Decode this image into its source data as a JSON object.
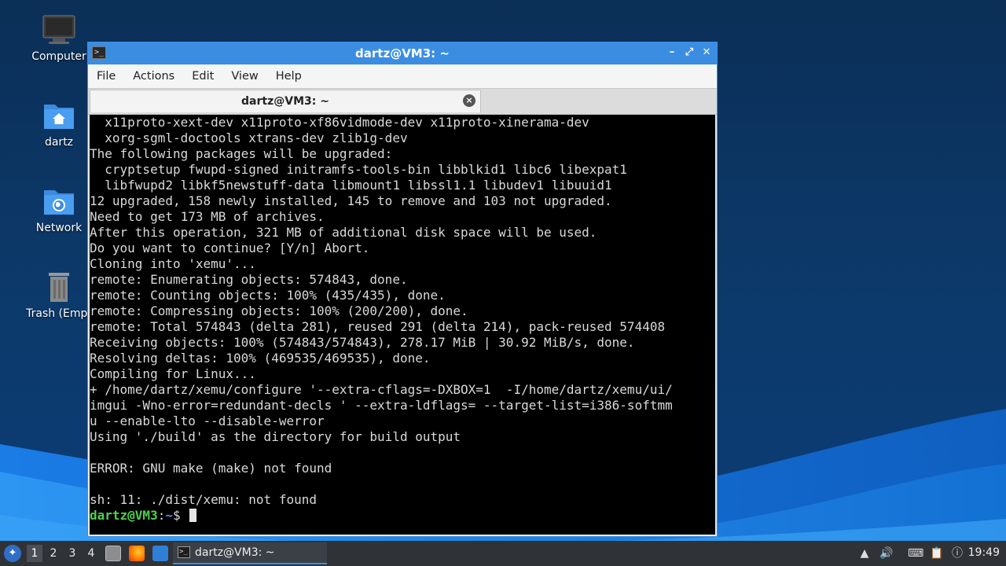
{
  "desktop": {
    "icons": [
      {
        "label": "Computer",
        "icon": "computer-icon"
      },
      {
        "label": "dartz",
        "icon": "home-folder-icon"
      },
      {
        "label": "Network",
        "icon": "network-folder-icon"
      },
      {
        "label": "Trash (Empt",
        "icon": "trash-icon"
      }
    ]
  },
  "window": {
    "title": "dartz@VM3: ~",
    "menu": [
      "File",
      "Actions",
      "Edit",
      "View",
      "Help"
    ],
    "tab_title": "dartz@VM3: ~"
  },
  "terminal": {
    "lines": [
      "  x11proto-xext-dev x11proto-xf86vidmode-dev x11proto-xinerama-dev",
      "  xorg-sgml-doctools xtrans-dev zlib1g-dev",
      "The following packages will be upgraded:",
      "  cryptsetup fwupd-signed initramfs-tools-bin libblkid1 libc6 libexpat1",
      "  libfwupd2 libkf5newstuff-data libmount1 libssl1.1 libudev1 libuuid1",
      "12 upgraded, 158 newly installed, 145 to remove and 103 not upgraded.",
      "Need to get 173 MB of archives.",
      "After this operation, 321 MB of additional disk space will be used.",
      "Do you want to continue? [Y/n] Abort.",
      "Cloning into 'xemu'...",
      "remote: Enumerating objects: 574843, done.",
      "remote: Counting objects: 100% (435/435), done.",
      "remote: Compressing objects: 100% (200/200), done.",
      "remote: Total 574843 (delta 281), reused 291 (delta 214), pack-reused 574408",
      "Receiving objects: 100% (574843/574843), 278.17 MiB | 30.92 MiB/s, done.",
      "Resolving deltas: 100% (469535/469535), done.",
      "Compiling for Linux...",
      "+ /home/dartz/xemu/configure '--extra-cflags=-DXBOX=1  -I/home/dartz/xemu/ui/",
      "imgui -Wno-error=redundant-decls ' --extra-ldflags= --target-list=i386-softmm",
      "u --enable-lto --disable-werror",
      "Using './build' as the directory for build output",
      "",
      "ERROR: GNU make (make) not found",
      "",
      "sh: 11: ./dist/xemu: not found"
    ],
    "prompt_user": "dartz@VM3",
    "prompt_sep": ":",
    "prompt_path": "~",
    "prompt_symbol": "$ "
  },
  "taskbar": {
    "workspaces": [
      "1",
      "2",
      "3",
      "4"
    ],
    "active_workspace": "1",
    "task_label": "dartz@VM3: ~",
    "clock": "19:49"
  },
  "colors": {
    "titlebar": "#3b8de2",
    "terminal_bg": "#000000",
    "prompt_user": "#4fd14f",
    "prompt_path": "#5c8cf0"
  }
}
